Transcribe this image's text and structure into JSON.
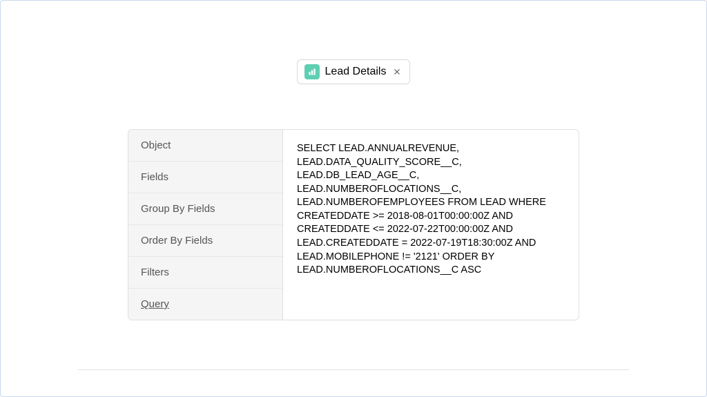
{
  "chip": {
    "label": "Lead Details",
    "icon_name": "report-icon"
  },
  "sidebar": {
    "items": [
      {
        "label": "Object"
      },
      {
        "label": "Fields"
      },
      {
        "label": "Group By Fields"
      },
      {
        "label": "Order By Fields"
      },
      {
        "label": "Filters"
      },
      {
        "label": "Query"
      }
    ],
    "active_index": 5
  },
  "content": {
    "query": "SELECT LEAD.ANNUALREVENUE, LEAD.DATA_QUALITY_SCORE__C, LEAD.DB_LEAD_AGE__C, LEAD.NUMBEROFLOCATIONS__C, LEAD.NUMBEROFEMPLOYEES FROM LEAD WHERE CREATEDDATE >= 2018-08-01T00:00:00Z AND CREATEDDATE <= 2022-07-22T00:00:00Z AND LEAD.CREATEDDATE = 2022-07-19T18:30:00Z AND LEAD.MOBILEPHONE != '2121' ORDER BY LEAD.NUMBEROFLOCATIONS__C ASC"
  }
}
